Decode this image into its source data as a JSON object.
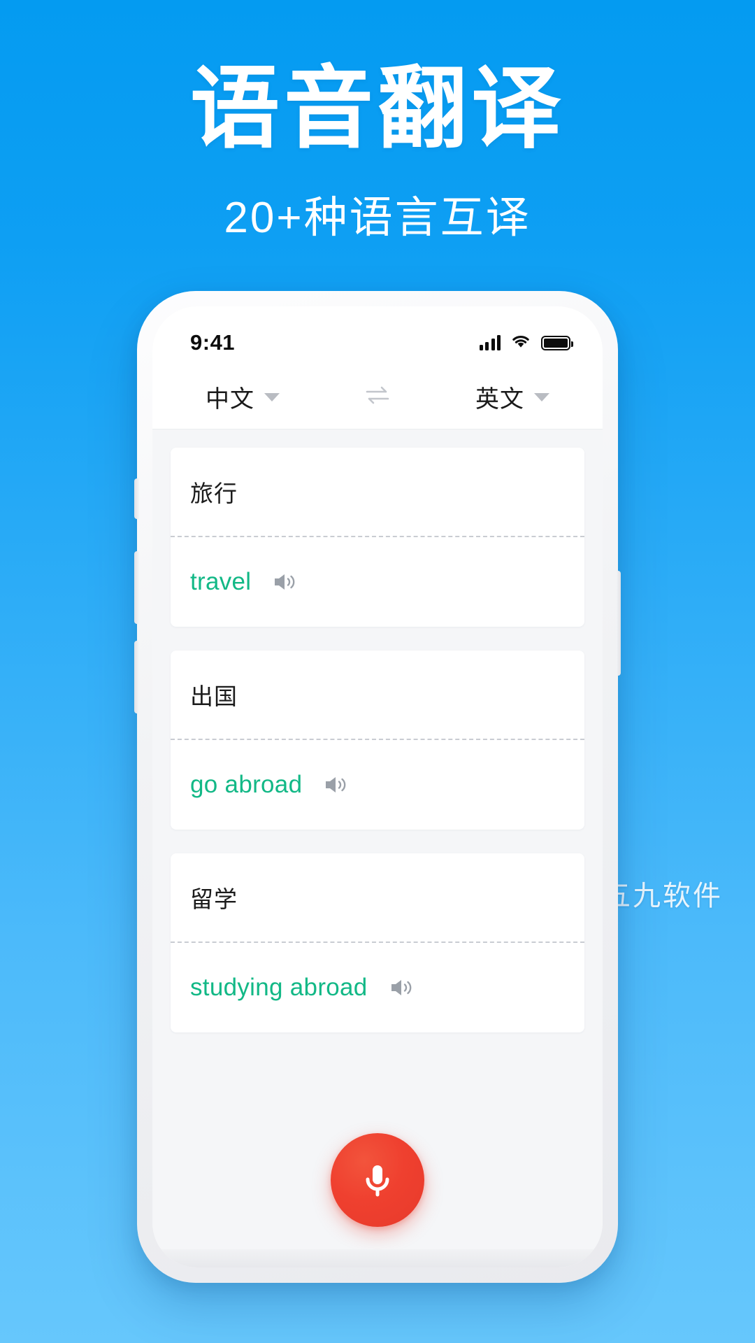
{
  "promo": {
    "title": "语音翻译",
    "subtitle": "20+种语言互译"
  },
  "watermark": "五九软件",
  "theme": {
    "bg_top": "#049BF1",
    "bg_bottom": "#66C7FC",
    "translation_color": "#12b886",
    "mic_color": "#EE3B2E"
  },
  "phone": {
    "statusbar": {
      "time": "9:41",
      "signal_icon": "signal-bars-icon",
      "wifi_icon": "wifi-icon",
      "battery_icon": "battery-full-icon"
    },
    "language_bar": {
      "source_language": "中文",
      "target_language": "英文",
      "swap_icon": "swap-arrows-icon",
      "caret_icon": "chevron-down-icon"
    },
    "cards": [
      {
        "source": "旅行",
        "translation": "travel",
        "speaker_icon": "speaker-icon"
      },
      {
        "source": "出国",
        "translation": "go abroad",
        "speaker_icon": "speaker-icon"
      },
      {
        "source": "留学",
        "translation": "studying abroad",
        "speaker_icon": "speaker-icon"
      }
    ],
    "mic_button": {
      "icon": "microphone-icon"
    }
  }
}
